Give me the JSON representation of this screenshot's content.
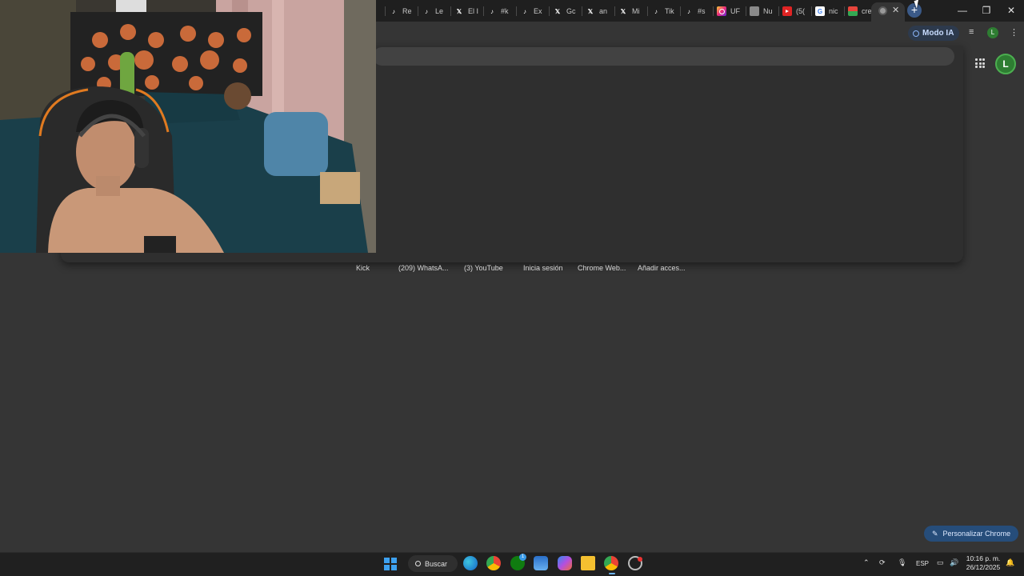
{
  "browser": {
    "tabs": [
      {
        "label": "Re",
        "icon": "tiktok-icon"
      },
      {
        "label": "Le",
        "icon": "tiktok-icon"
      },
      {
        "label": "El I",
        "icon": "x-icon"
      },
      {
        "label": "#k",
        "icon": "tiktok-icon"
      },
      {
        "label": "Ex",
        "icon": "tiktok-icon"
      },
      {
        "label": "Gc",
        "icon": "x-icon"
      },
      {
        "label": "an",
        "icon": "x-icon"
      },
      {
        "label": "Mi",
        "icon": "x-icon"
      },
      {
        "label": "Tik",
        "icon": "tiktok-icon"
      },
      {
        "label": "#s",
        "icon": "tiktok-icon"
      },
      {
        "label": "UF",
        "icon": "instagram-icon"
      },
      {
        "label": "Nu",
        "icon": "globe-icon"
      },
      {
        "label": "(5(",
        "icon": "youtube-icon"
      },
      {
        "label": "nic",
        "icon": "google-icon"
      },
      {
        "label": "cre",
        "icon": "chrome-web-store-icon"
      }
    ],
    "active_tab": {
      "icon": "chrome-icon",
      "close": "✕"
    },
    "new_tab": "+",
    "window_controls": {
      "minimize": "—",
      "restore": "❐",
      "close": "✕"
    },
    "toolbar": {
      "ai_mode_label": "Modo IA",
      "profile_initial": "L"
    }
  },
  "new_tab_page": {
    "profile_initial": "L",
    "shortcuts": [
      "Kick",
      "(209) WhatsA...",
      "(3) YouTube",
      "Inicia sesión",
      "Chrome Web...",
      "Añadir acces..."
    ],
    "customize_label": "Personalizar Chrome"
  },
  "taskbar": {
    "search_label": "Buscar",
    "xbox_badge": "1",
    "language": "ESP",
    "time": "10:16 p. m.",
    "date": "26/12/2025"
  },
  "colors": {
    "background": "#353535",
    "tabstrip": "#1f1f1f",
    "accent_blue": "#264d7a",
    "profile_green": "#2e7d32"
  }
}
